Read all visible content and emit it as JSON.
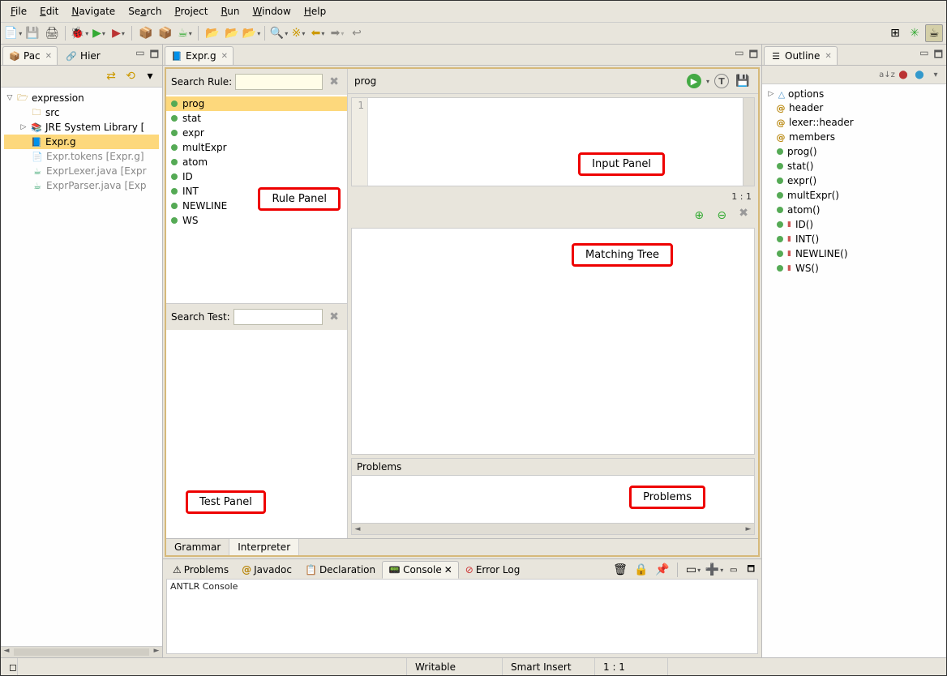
{
  "menu": {
    "file": "File",
    "edit": "Edit",
    "navigate": "Navigate",
    "search": "Search",
    "project": "Project",
    "run": "Run",
    "window": "Window",
    "help": "Help"
  },
  "left_tabs": {
    "pac": "Pac",
    "hier": "Hier"
  },
  "project": {
    "root": "expression",
    "src": "src",
    "jre": "JRE System Library [",
    "exprg": "Expr.g",
    "tokens": "Expr.tokens [Expr.g]",
    "lexer": "ExprLexer.java [Expr",
    "parser": "ExprParser.java [Exp"
  },
  "editor": {
    "tab": "Expr.g",
    "search_rule_label": "Search Rule:",
    "search_test_label": "Search Test:",
    "rules": [
      "prog",
      "stat",
      "expr",
      "multExpr",
      "atom",
      "ID",
      "INT",
      "NEWLINE",
      "WS"
    ],
    "selected_rule": "prog",
    "gutter_line": "1",
    "cursor_status": "1 : 1",
    "problems_header": "Problems",
    "bottom_tabs": {
      "grammar": "Grammar",
      "interpreter": "Interpreter"
    }
  },
  "annotations": {
    "rule_panel": "Rule Panel",
    "test_panel": "Test Panel",
    "input_panel": "Input Panel",
    "matching_tree": "Matching Tree",
    "problems": "Problems"
  },
  "outline": {
    "tab": "Outline",
    "items": [
      {
        "kind": "opt",
        "label": "options"
      },
      {
        "kind": "at",
        "label": "header"
      },
      {
        "kind": "at",
        "label": "lexer::header"
      },
      {
        "kind": "at",
        "label": "members"
      },
      {
        "kind": "rule",
        "label": "prog()"
      },
      {
        "kind": "rule",
        "label": "stat()"
      },
      {
        "kind": "rule",
        "label": "expr()"
      },
      {
        "kind": "rule",
        "label": "multExpr()"
      },
      {
        "kind": "rule",
        "label": "atom()"
      },
      {
        "kind": "lexrule",
        "label": "ID()"
      },
      {
        "kind": "lexrule",
        "label": "INT()"
      },
      {
        "kind": "lexrule",
        "label": "NEWLINE()"
      },
      {
        "kind": "lexrule",
        "label": "WS()"
      }
    ]
  },
  "console": {
    "tabs": {
      "problems": "Problems",
      "javadoc": "Javadoc",
      "declaration": "Declaration",
      "console": "Console",
      "errorlog": "Error Log"
    },
    "title": "ANTLR Console"
  },
  "status": {
    "writable": "Writable",
    "smart": "Smart Insert",
    "pos": "1 : 1"
  }
}
